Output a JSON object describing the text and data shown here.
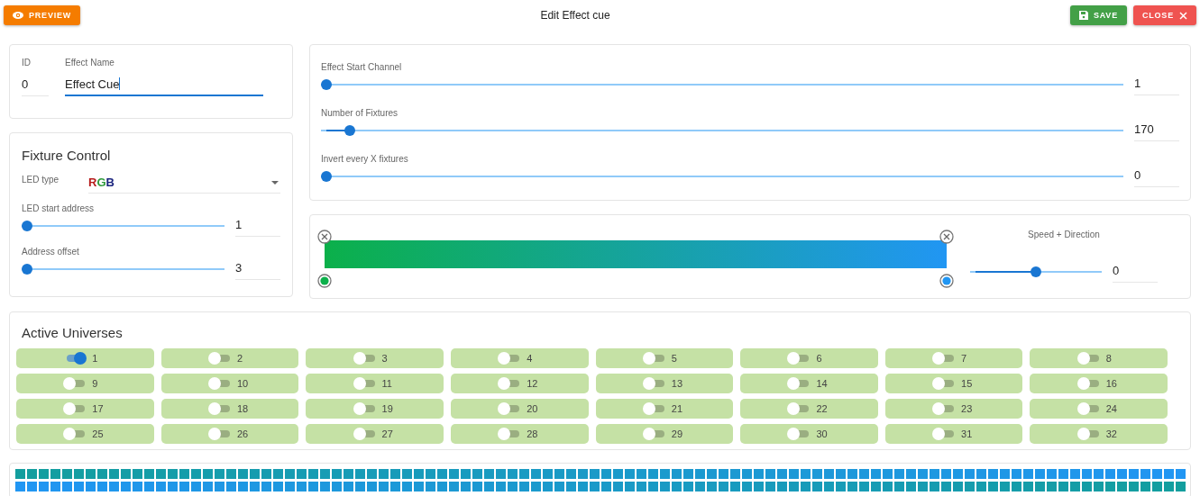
{
  "header": {
    "preview_button": "PREVIEW",
    "title": "Edit Effect cue",
    "save_button": "SAVE",
    "close_button": "CLOSE"
  },
  "identity": {
    "id_label": "ID",
    "id_value": "0",
    "name_label": "Effect Name",
    "name_value": "Effect Cue"
  },
  "fixture_control": {
    "title": "Fixture Control",
    "led_type_label": "LED type",
    "led_type_letters": [
      {
        "text": "R",
        "color": "#b71c1c"
      },
      {
        "text": "G",
        "color": "#2e9a3a"
      },
      {
        "text": "B",
        "color": "#1a237e"
      }
    ],
    "sliders": [
      {
        "label": "LED start address",
        "level": 0,
        "value": "1"
      },
      {
        "label": "Address offset",
        "level": 0,
        "value": "3"
      }
    ]
  },
  "channel_settings": {
    "sliders": [
      {
        "label": "Effect Start Channel",
        "level": 0,
        "value": "1"
      },
      {
        "label": "Number of Fixtures",
        "level": 0.03,
        "value": "170"
      },
      {
        "label": "Invert every X fixtures",
        "level": 0,
        "value": "0"
      }
    ]
  },
  "gradient": {
    "stops": [
      {
        "color": "#0bb04a"
      },
      {
        "color": "#2196f3"
      }
    ],
    "speed": {
      "label": "Speed + Direction",
      "level": 0.5,
      "value": "0"
    }
  },
  "universes": {
    "title": "Active Universes",
    "items": [
      {
        "label": "1",
        "on": true
      },
      {
        "label": "2",
        "on": false
      },
      {
        "label": "3",
        "on": false
      },
      {
        "label": "4",
        "on": false
      },
      {
        "label": "5",
        "on": false
      },
      {
        "label": "6",
        "on": false
      },
      {
        "label": "7",
        "on": false
      },
      {
        "label": "8",
        "on": false
      },
      {
        "label": "9",
        "on": false
      },
      {
        "label": "10",
        "on": false
      },
      {
        "label": "11",
        "on": false
      },
      {
        "label": "12",
        "on": false
      },
      {
        "label": "13",
        "on": false
      },
      {
        "label": "14",
        "on": false
      },
      {
        "label": "15",
        "on": false
      },
      {
        "label": "16",
        "on": false
      },
      {
        "label": "17",
        "on": false
      },
      {
        "label": "18",
        "on": false
      },
      {
        "label": "19",
        "on": false
      },
      {
        "label": "20",
        "on": false
      },
      {
        "label": "21",
        "on": false
      },
      {
        "label": "22",
        "on": false
      },
      {
        "label": "23",
        "on": false
      },
      {
        "label": "24",
        "on": false
      },
      {
        "label": "25",
        "on": false
      },
      {
        "label": "26",
        "on": false
      },
      {
        "label": "27",
        "on": false
      },
      {
        "label": "28",
        "on": false
      },
      {
        "label": "29",
        "on": false
      },
      {
        "label": "30",
        "on": false
      },
      {
        "label": "31",
        "on": false
      },
      {
        "label": "32",
        "on": false
      }
    ]
  }
}
